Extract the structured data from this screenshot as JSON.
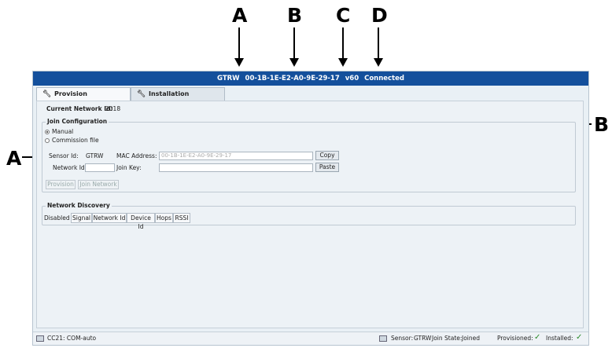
{
  "callouts": {
    "top": [
      "A",
      "B",
      "C",
      "D"
    ],
    "side_left": "A",
    "side_right": "B"
  },
  "titlebar": {
    "sensor": "GTRW",
    "mac": "00-1B-1E-E2-A0-9E-29-17",
    "version": "v60",
    "status": "Connected"
  },
  "tabs": [
    {
      "label": "Provision",
      "icon": "wrench-icon"
    },
    {
      "label": "Installation",
      "icon": "wrench-icon"
    }
  ],
  "network": {
    "label": "Current Network Id:",
    "value": "2018"
  },
  "join_config": {
    "legend": "Join Configuration",
    "manual": "Manual",
    "commission": "Commission file",
    "sensor_label": "Sensor Id:",
    "sensor_value": "GTRW",
    "mac_label": "MAC Address:",
    "mac_value": "00-1B-1E-E2-A0-9E-29-17",
    "copy": "Copy",
    "network_label": "Network Id:",
    "network_value": "",
    "join_key_label": "Join Key:",
    "join_key_value": "",
    "paste": "Paste",
    "provision": "Provision",
    "join_network": "Join Network"
  },
  "discovery": {
    "legend": "Network Discovery",
    "state": "Disabled",
    "columns": [
      "Signal",
      "Network Id",
      "Device Id",
      "Hops",
      "RSSI"
    ]
  },
  "statusbar": {
    "port": "CC21: COM-auto",
    "sensor_label": "Sensor:",
    "sensor_value": "GTRW",
    "join_label": "Join State:",
    "join_value": "Joined",
    "provisioned_label": "Provisioned:",
    "installed_label": "Installed:"
  },
  "colors": {
    "titlebar": "#14509c",
    "check": "#2a8a2a"
  }
}
